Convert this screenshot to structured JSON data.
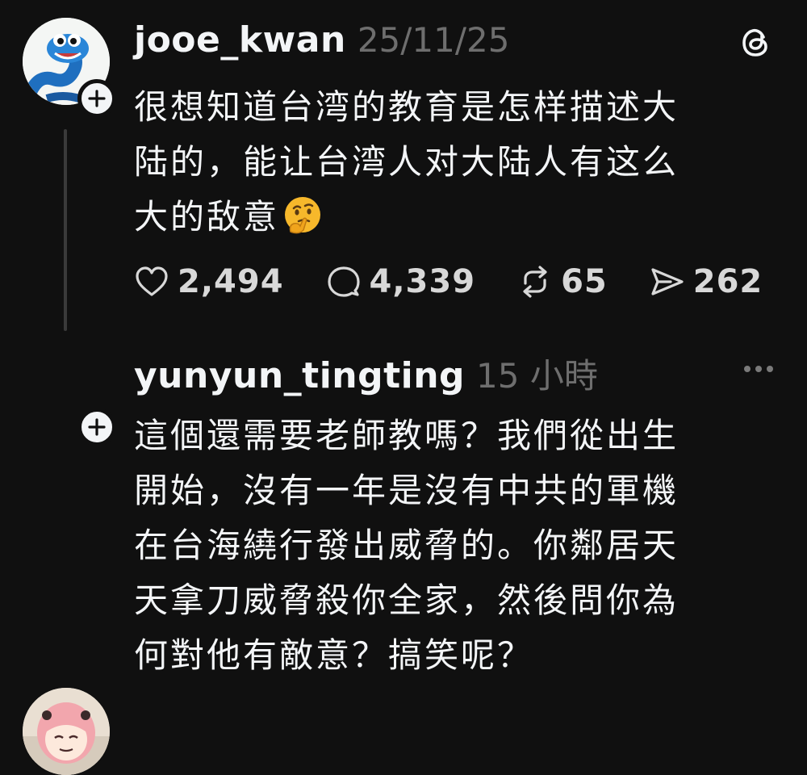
{
  "posts": [
    {
      "username": "jooe_kwan",
      "timestamp": "25/11/25",
      "lines": [
        "很想知道台湾的教育是怎样描述大",
        "陆的，能让台湾人对大陆人有这么",
        "大的敌意"
      ],
      "emoji": "thinking-face",
      "stats": {
        "likes": "2,494",
        "replies": "4,339",
        "reposts": "65",
        "shares": "262"
      }
    },
    {
      "username": "yunyun_tingting",
      "timestamp": "15 小時",
      "lines": [
        "這個還需要老師教嗎？我們從出生",
        "開始，沒有一年是沒有中共的軍機",
        "在台海繞行發出威脅的。你鄰居天",
        "天拿刀威脅殺你全家，然後問你為",
        "何對他有敵意？搞笑呢？"
      ]
    }
  ],
  "icons": {
    "logo": "threads-logo-icon",
    "more": "more-options-icon",
    "follow": "plus-icon",
    "like": "heart-icon",
    "reply": "comment-icon",
    "repost": "repost-icon",
    "share": "send-icon"
  },
  "colors": {
    "background": "#101010",
    "text": "#f3f5f7",
    "muted": "#6e6e6e"
  }
}
